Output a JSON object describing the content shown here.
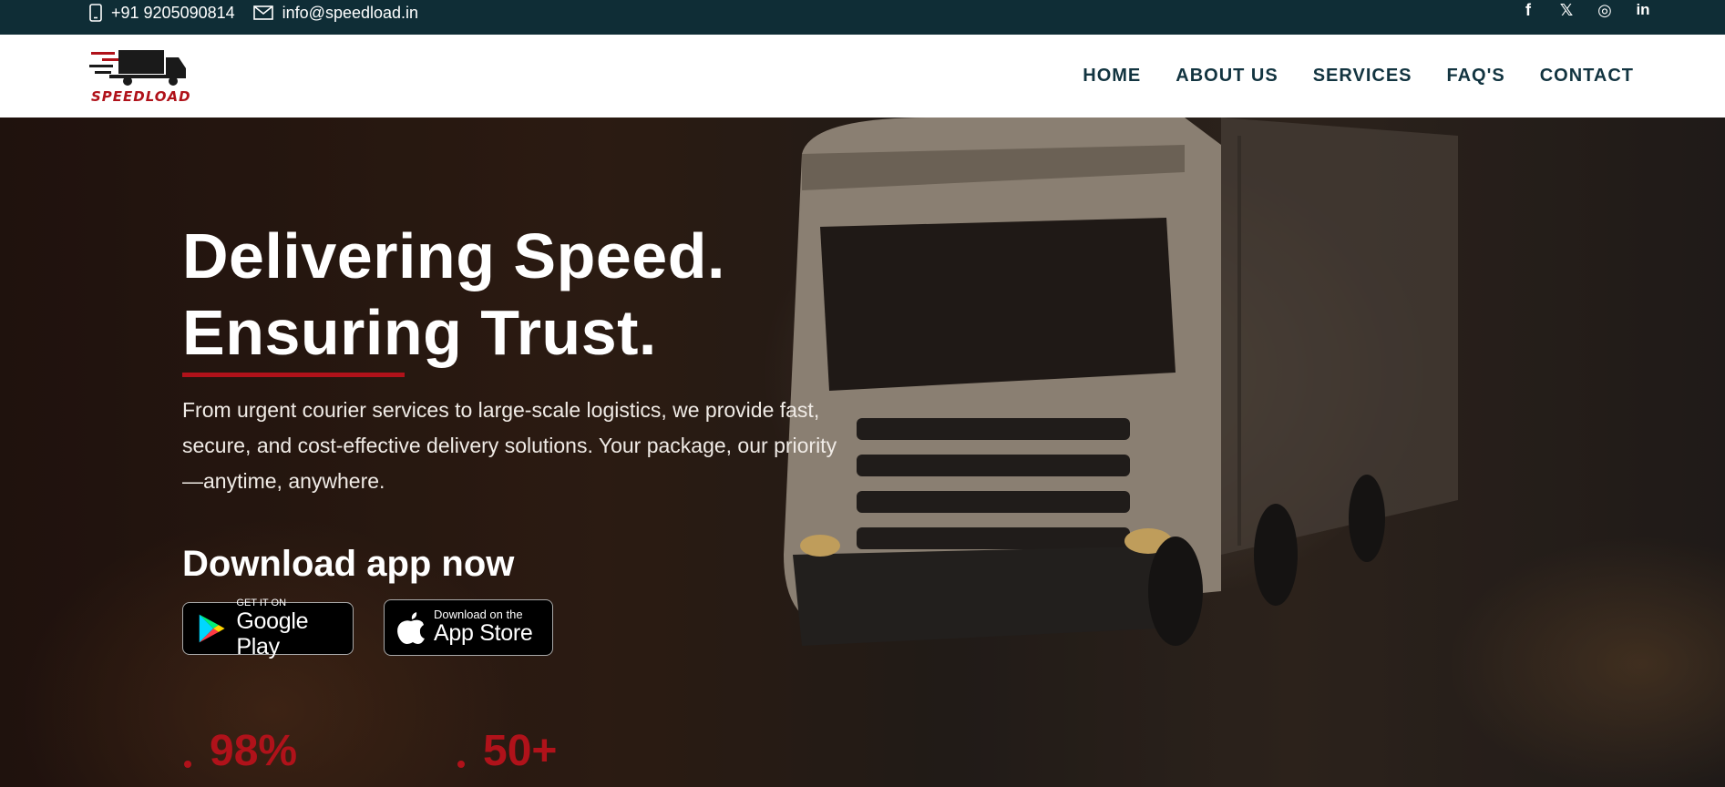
{
  "topbar": {
    "phone": "+91 9205090814",
    "email": "info@speedload.in",
    "social": [
      {
        "icon": "facebook-icon",
        "glyph": "f"
      },
      {
        "icon": "x-icon",
        "glyph": "𝕏"
      },
      {
        "icon": "instagram-icon",
        "glyph": "◎"
      },
      {
        "icon": "linkedin-icon",
        "glyph": "in"
      }
    ]
  },
  "header": {
    "logo_text": "SPEEDLOAD",
    "nav": [
      "HOME",
      "ABOUT US",
      "SERVICES",
      "FAQ'S",
      "CONTACT"
    ]
  },
  "hero": {
    "headline_line1": "Delivering Speed.",
    "headline_line2": "Ensuring Trust.",
    "subtext": "From urgent courier services to large-scale logistics, we provide fast, secure, and cost-effective delivery solutions. Your package, our priority—anytime, anywhere.",
    "download_title": "Download app now",
    "google_small": "GET IT ON",
    "google_big": "Google Play",
    "apple_small": "Download on the",
    "apple_big": "App Store",
    "stats": [
      "98%",
      "50+"
    ]
  },
  "colors": {
    "topbar_bg": "#0f2d36",
    "accent_red": "#b0121a",
    "nav_text": "#123440"
  }
}
